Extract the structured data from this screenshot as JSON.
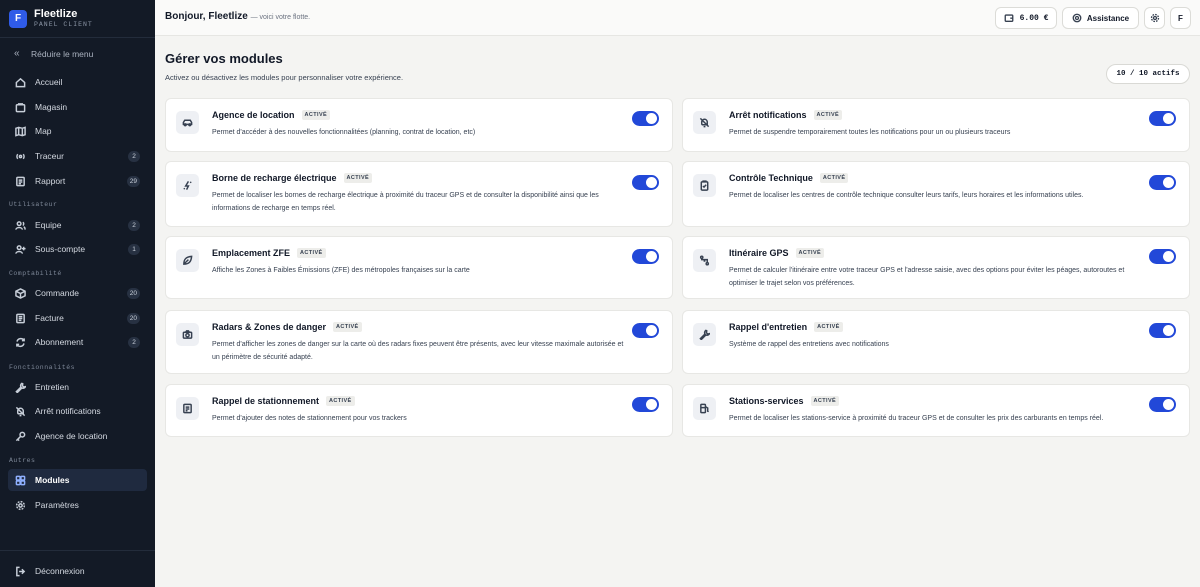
{
  "brand": {
    "logo_letter": "F",
    "name": "Fleetlize",
    "subtitle": "PANEL CLIENT"
  },
  "sidebar": {
    "collapse_label": "Réduire le menu",
    "items": [
      {
        "label": "Accueil",
        "icon": "home-icon"
      },
      {
        "label": "Magasin",
        "icon": "store-icon"
      },
      {
        "label": "Map",
        "icon": "map-icon"
      },
      {
        "label": "Traceur",
        "icon": "signal-icon",
        "badge": "2"
      },
      {
        "label": "Rapport",
        "icon": "report-icon",
        "badge": "29"
      },
      {
        "label": "Equipe",
        "icon": "team-icon",
        "badge": "2"
      },
      {
        "label": "Sous-compte",
        "icon": "user-plus-icon",
        "badge": "1"
      },
      {
        "label": "Commande",
        "icon": "box-icon",
        "badge": "20"
      },
      {
        "label": "Facture",
        "icon": "invoice-icon",
        "badge": "20"
      },
      {
        "label": "Abonnement",
        "icon": "refresh-icon",
        "badge": "2"
      },
      {
        "label": "Entretien",
        "icon": "wrench-icon"
      },
      {
        "label": "Arrêt notifications",
        "icon": "bell-off-icon"
      },
      {
        "label": "Agence de location",
        "icon": "key-icon"
      },
      {
        "label": "Modules",
        "icon": "modules-icon",
        "active": true
      },
      {
        "label": "Paramètres",
        "icon": "gear-icon"
      }
    ],
    "sections": [
      "Utilisateur",
      "Comptabilité",
      "Fonctionnalités",
      "Autres"
    ],
    "logout_label": "Déconnexion"
  },
  "header": {
    "greeting": "Bonjour, Fleetlize",
    "greeting_sub": "— voici votre flotte.",
    "balance": "6.00 €",
    "assistance_label": "Assistance",
    "avatar_letter": "F"
  },
  "main": {
    "title": "Gérer vos modules",
    "subtitle": "Activez ou désactivez les modules pour personnaliser votre expérience.",
    "active_count": "10 / 10 actifs",
    "modules": [
      {
        "title": "Agence de location",
        "status": "ACTIVÉ",
        "icon": "car-icon",
        "desc": "Permet d'accéder à des nouvelles fonctionnalitées (planning, contrat de location, etc)"
      },
      {
        "title": "Arrêt notifications",
        "status": "ACTIVÉ",
        "icon": "bell-off-icon",
        "desc": "Permet de suspendre temporairement toutes les notifications pour un ou plusieurs traceurs"
      },
      {
        "title": "Borne de recharge électrique",
        "status": "ACTIVÉ",
        "icon": "plug-icon",
        "desc": "Permet de localiser les bornes de recharge électrique à proximité du traceur GPS et de consulter la disponibilité ainsi que les informations de recharge en temps réel."
      },
      {
        "title": "Contrôle Technique",
        "status": "ACTIVÉ",
        "icon": "clipboard-check-icon",
        "desc": "Permet de localiser les centres de contrôle technique consulter leurs tarifs, leurs horaires et les informations utiles."
      },
      {
        "title": "Emplacement ZFE",
        "status": "ACTIVÉ",
        "icon": "leaf-icon",
        "desc": "Affiche les Zones à Faibles Émissions (ZFE) des métropoles françaises sur la carte"
      },
      {
        "title": "Itinéraire GPS",
        "status": "ACTIVÉ",
        "icon": "route-icon",
        "desc": "Permet de calculer l'itinéraire entre votre traceur GPS et l'adresse saisie, avec des options pour éviter les péages, autoroutes et optimiser le trajet selon vos préférences."
      },
      {
        "title": "Radars & Zones de danger",
        "status": "ACTIVÉ",
        "icon": "camera-icon",
        "desc": "Permet d'afficher les zones de danger sur la carte où des radars fixes peuvent être présents, avec leur vitesse maximale autorisée et un périmètre de sécurité adapté."
      },
      {
        "title": "Rappel d'entretien",
        "status": "ACTIVÉ",
        "icon": "wrench-icon",
        "desc": "Système de rappel des entretiens avec notifications"
      },
      {
        "title": "Rappel de stationnement",
        "status": "ACTIVÉ",
        "icon": "note-icon",
        "desc": "Permet d'ajouter des notes de stationnement pour vos trackers"
      },
      {
        "title": "Stations-services",
        "status": "ACTIVÉ",
        "icon": "fuel-icon",
        "desc": "Permet de localiser les stations-service à proximité du traceur GPS et de consulter les prix des carburants en temps réel."
      }
    ]
  },
  "colors": {
    "sidebar_bg": "#131a26",
    "accent": "#2248d8",
    "page_bg": "#f4f4f2"
  }
}
